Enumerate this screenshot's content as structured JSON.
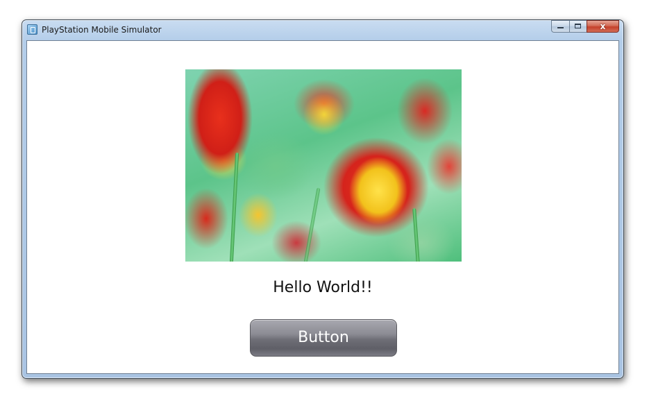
{
  "window": {
    "title": "PlayStation Mobile Simulator",
    "close_glyph": "x"
  },
  "content": {
    "image": {
      "description_icon": "tulip-photo"
    },
    "label_text": "Hello World!!",
    "button_label": "Button"
  },
  "colors": {
    "titlebar": "#b3cde9",
    "close_button": "#c4402a",
    "button_face": "#6e6e76",
    "button_text": "#ffffff"
  }
}
